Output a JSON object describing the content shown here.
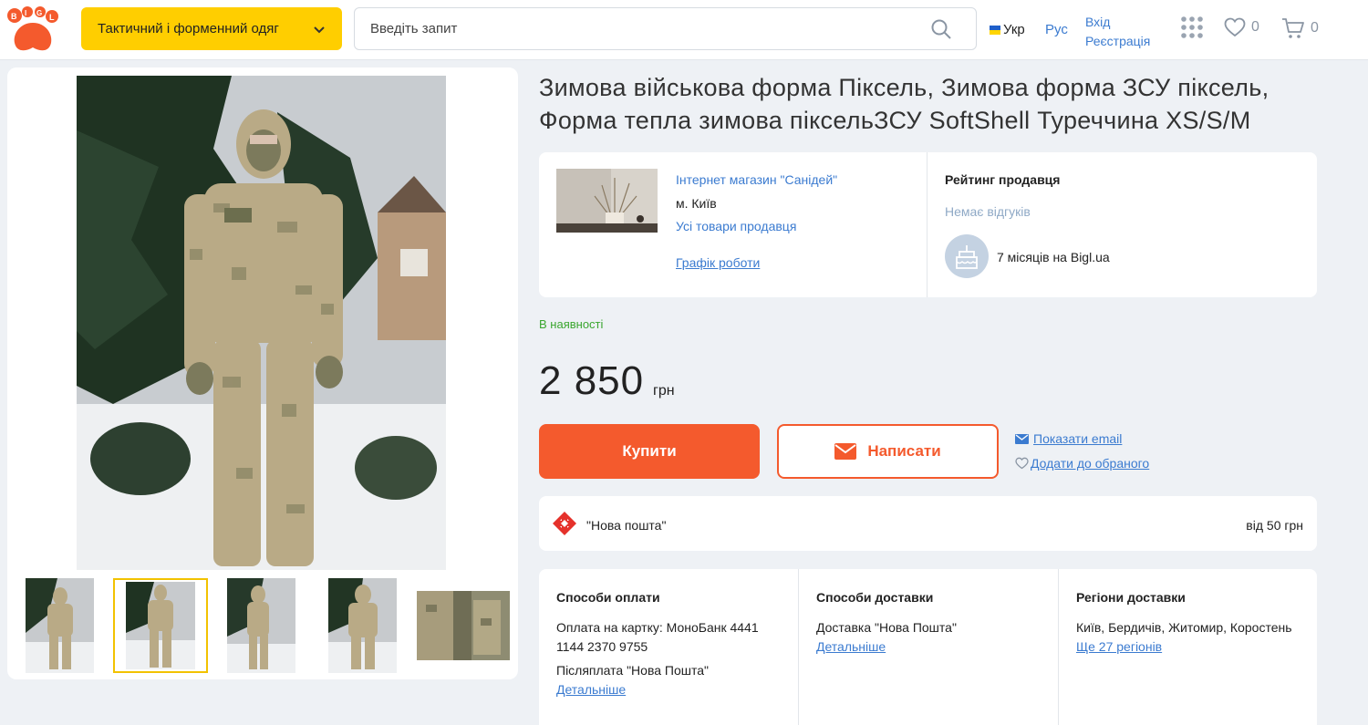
{
  "header": {
    "logo_text": "BIGL",
    "category_label": "Тактичний і форменний одяг",
    "search_placeholder": "Введіть запит",
    "lang_ua": "Укр",
    "lang_ru": "Рус",
    "login": "Вхід",
    "register": "Реєстрація",
    "favorites_count": "0",
    "cart_count": "0",
    "icons": [
      "search-icon",
      "chevron-down-icon",
      "apps-grid-icon",
      "heart-icon",
      "cart-icon"
    ]
  },
  "product": {
    "title_line1": "Зимова військова форма Піксель, Зимова форма ЗСУ піксель,",
    "title_line2": "Форма тепла зимова піксельЗСУ SoftShell Туреччина XS/S/M",
    "stock": "В наявності",
    "price": "2 850",
    "currency": "грн",
    "buy_label": "Купити",
    "write_label": "Написати",
    "show_email": "Показати email",
    "add_favorite": "Додати до обраного",
    "thumbnail_count": 5,
    "selected_thumbnail": 2
  },
  "seller": {
    "shop_name": "Інтернет магазин \"Санідей\"",
    "city": "м. Київ",
    "all_goods": "Усі товари продавця",
    "schedule": "Графік роботи",
    "rating_title": "Рейтинг продавця",
    "rating_text": "Немає відгуків",
    "on_site": "7 місяців на Bigl.ua"
  },
  "delivery": {
    "carrier": "\"Нова пошта\"",
    "price": "від 50 грн"
  },
  "info": {
    "payment": {
      "title": "Способи оплати",
      "text1": "Оплата на картку: МоноБанк 4441 1144 2370 9755",
      "text2": "Післяплата \"Нова Пошта\"",
      "link": "Детальніше"
    },
    "shipping": {
      "title": "Способи доставки",
      "text1": "Доставка \"Нова Пошта\"",
      "link": "Детальніше"
    },
    "regions": {
      "title": "Регіони доставки",
      "text1": "Київ, Бердичів, Житомир, Коростень",
      "link": "Ще 27 регіонів"
    }
  },
  "colors": {
    "brand_orange": "#f45a2d",
    "category_yellow": "#ffce00",
    "link_blue": "#3b7bd0",
    "stock_green": "#3aa62f"
  }
}
